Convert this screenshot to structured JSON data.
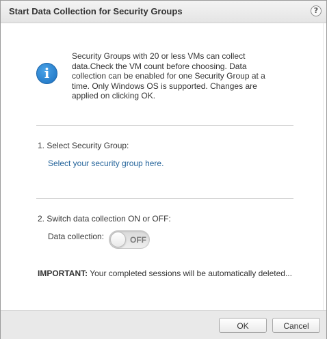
{
  "dialog": {
    "title": "Start Data Collection for Security Groups",
    "help_label": "?"
  },
  "info": {
    "icon": "info-icon",
    "icon_glyph": "i",
    "text": "Security Groups with 20 or less VMs can collect data.Check the VM count before choosing. Data collection can be enabled for one Security Group at a time. Only Windows OS is supported. Changes are applied on clicking OK."
  },
  "step1": {
    "label": "1. Select Security Group:",
    "link_text": "Select your security group here."
  },
  "step2": {
    "label": "2. Switch data collection ON or OFF:",
    "field_label": "Data collection:",
    "toggle_state": "OFF"
  },
  "important": {
    "prefix": "IMPORTANT:",
    "text": " Your completed sessions will be automatically deleted..."
  },
  "footer": {
    "ok_label": "OK",
    "cancel_label": "Cancel"
  },
  "colors": {
    "link": "#23639a",
    "info_icon": "#1a6fbf"
  }
}
